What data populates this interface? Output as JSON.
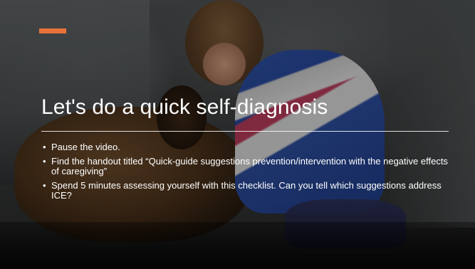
{
  "slide": {
    "accent_color": "#e8733a",
    "title": "Let's do a quick self-diagnosis",
    "bullet_symbol": "•",
    "bullets": [
      "Pause the video.",
      "Find the handout titled “Quick-guide suggestions prevention/intervention with the negative effects of caregiving”",
      "Spend 5 minutes assessing yourself with this checklist. Can you tell which suggestions address ICE?"
    ]
  }
}
